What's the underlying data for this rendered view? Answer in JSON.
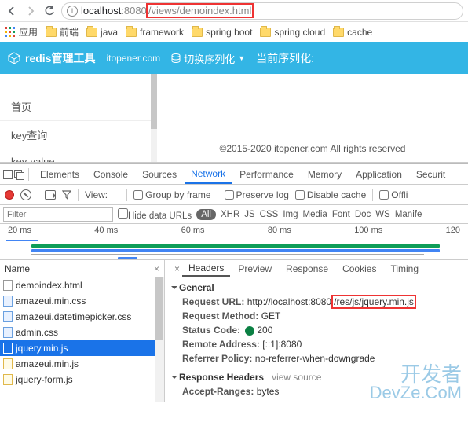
{
  "browser": {
    "url_host": "localhost",
    "url_port": ":8080",
    "url_path": "/views/demoindex.html"
  },
  "bookmarks": {
    "apps": "应用",
    "items": [
      "前端",
      "java",
      "framework",
      "spring boot",
      "spring cloud",
      "cache"
    ]
  },
  "header": {
    "title": "redis管理工具",
    "subtitle": "itopener.com",
    "switch": "切换序列化",
    "current": "当前序列化:"
  },
  "sidebar": {
    "items": [
      "首页",
      "key查询",
      "key-value"
    ]
  },
  "footer": "©2015-2020 itopener.com All rights reserved",
  "devtools": {
    "tabs": [
      "Elements",
      "Console",
      "Sources",
      "Network",
      "Performance",
      "Memory",
      "Application",
      "Securit"
    ],
    "active_tab": "Network",
    "toolbar": {
      "view": "View:",
      "group": "Group by frame",
      "preserve": "Preserve log",
      "disable": "Disable cache",
      "offline": "Offli"
    },
    "filter": {
      "placeholder": "Filter",
      "hide": "Hide data URLs",
      "types": [
        "All",
        "XHR",
        "JS",
        "CSS",
        "Img",
        "Media",
        "Font",
        "Doc",
        "WS",
        "Manife"
      ]
    },
    "timeline": [
      "20 ms",
      "40 ms",
      "60 ms",
      "80 ms",
      "100 ms",
      "120"
    ],
    "left": {
      "header": "Name",
      "rows": [
        {
          "name": "demoindex.html",
          "type": "doc",
          "sel": false
        },
        {
          "name": "amazeui.min.css",
          "type": "css",
          "sel": false
        },
        {
          "name": "amazeui.datetimepicker.css",
          "type": "css",
          "sel": false
        },
        {
          "name": "admin.css",
          "type": "css",
          "sel": false
        },
        {
          "name": "jquery.min.js",
          "type": "js",
          "sel": true
        },
        {
          "name": "amazeui.min.js",
          "type": "js",
          "sel": false
        },
        {
          "name": "jquery-form.js",
          "type": "js",
          "sel": false
        }
      ]
    },
    "right": {
      "tabs": [
        "Headers",
        "Preview",
        "Response",
        "Cookies",
        "Timing"
      ],
      "general": "General",
      "request_url_label": "Request URL:",
      "request_url_prefix": "http://localhost:8080",
      "request_url_suffix": "/res/js/jquery.min.js",
      "request_method_label": "Request Method:",
      "request_method": "GET",
      "status_label": "Status Code:",
      "status_code": "200",
      "remote_label": "Remote Address:",
      "remote": "[::1]:8080",
      "referrer_label": "Referrer Policy:",
      "referrer": "no-referrer-when-downgrade",
      "response_headers": "Response Headers",
      "view_source": "view source",
      "accept_label": "Accept-Ranges:",
      "accept": "bytes"
    }
  },
  "watermark": {
    "line1": "开发者",
    "line2": "DevZe.CoM"
  }
}
